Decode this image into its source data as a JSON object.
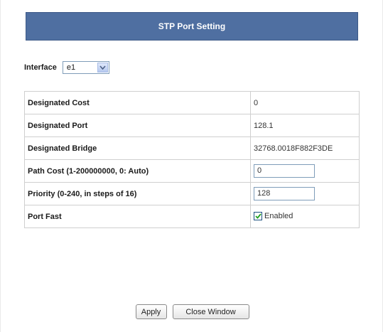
{
  "header": {
    "title": "STP Port Setting"
  },
  "interface": {
    "label": "Interface",
    "selected": "e1"
  },
  "rows": [
    {
      "label": "Designated Cost",
      "value": "0"
    },
    {
      "label": "Designated Port",
      "value": "128.1"
    },
    {
      "label": "Designated Bridge",
      "value": "32768.0018F882F3DE"
    },
    {
      "label": "Path Cost (1-200000000, 0: Auto)",
      "value": "0"
    },
    {
      "label": "Priority (0-240, in steps of 16)",
      "value": "128"
    },
    {
      "label": "Port Fast",
      "value": "Enabled",
      "checked": true
    }
  ],
  "buttons": {
    "apply": "Apply",
    "close": "Close Window"
  },
  "colors": {
    "header_bg": "#4f6fa1",
    "border": "#cfcfcf"
  }
}
